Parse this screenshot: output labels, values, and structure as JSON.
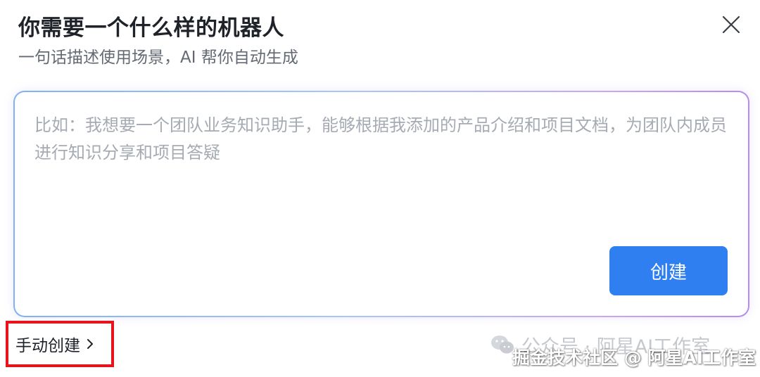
{
  "dialog": {
    "title": "你需要一个什么样的机器人",
    "subtitle": "一句话描述使用场景，AI 帮你自动生成"
  },
  "prompt": {
    "value": "",
    "placeholder": "比如：我想要一个团队业务知识助手，能够根据我添加的产品介绍和项目文档，为团队内成员进行知识分享和项目答疑"
  },
  "actions": {
    "create_label": "创建",
    "manual_create_label": "手动创建"
  },
  "watermark": {
    "wechat_text": "公众号 · 阿星AI工作室",
    "site_text": "掘金技术社区 @ 阿星AI工作室"
  },
  "icons": {
    "close": "close-icon",
    "chevron": "chevron-right-icon",
    "wechat": "wechat-icon"
  },
  "colors": {
    "primary": "#2f7ff0",
    "highlight_box": "#e8141c",
    "placeholder": "#a6abb3"
  }
}
